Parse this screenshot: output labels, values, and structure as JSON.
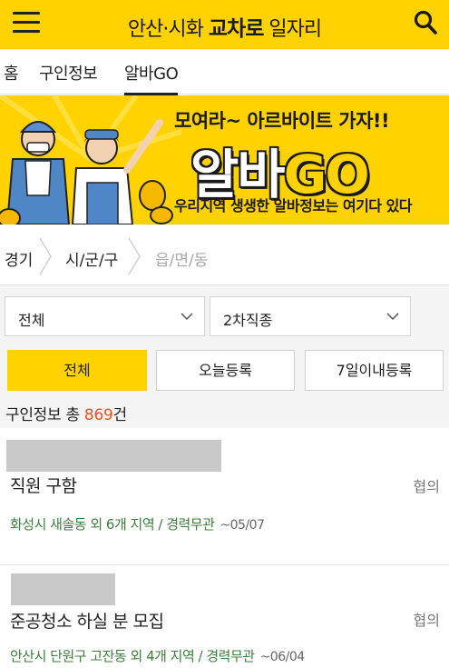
{
  "header": {
    "title_prefix": "안산·시화 ",
    "title_brand": "교차로",
    "title_suffix": " 일자리"
  },
  "tabs": [
    {
      "label": "홈"
    },
    {
      "label": "구인정보"
    },
    {
      "label": "알바GO",
      "active": true
    }
  ],
  "banner": {
    "headline": "모여라~ 아르바이트 가자!!",
    "logo_main": "알바",
    "logo_go": "GO",
    "subline": "우리지역 생생한 알바정보는 여기다 있다"
  },
  "regions": [
    {
      "label": "경기"
    },
    {
      "label": "시/군/구"
    },
    {
      "label": "읍/면/동",
      "disabled": true
    }
  ],
  "filters": {
    "select_category": "전체",
    "select_job_type": "2차직종",
    "buttons": [
      {
        "label": "전체",
        "active": true
      },
      {
        "label": "오늘등록",
        "active": false
      },
      {
        "label": "7일이내등록",
        "active": false
      }
    ]
  },
  "summary": {
    "prefix": "구인정보 총 ",
    "count": "869",
    "suffix": "건"
  },
  "jobs": [
    {
      "title": "직원 구함",
      "pay": "협의",
      "location": "화성시 새솔동 외 6개 지역 / 경력무관",
      "date": "~05/07"
    },
    {
      "title": "준공청소 하실 분 모집",
      "pay": "협의",
      "location": "안산시 단원구 고잔동 외 4개 지역 / 경력무관",
      "date": "~06/04"
    }
  ],
  "colors": {
    "brand_yellow": "#ffd200",
    "count_orange": "#e8521b",
    "location_green": "#3e7d3e"
  }
}
